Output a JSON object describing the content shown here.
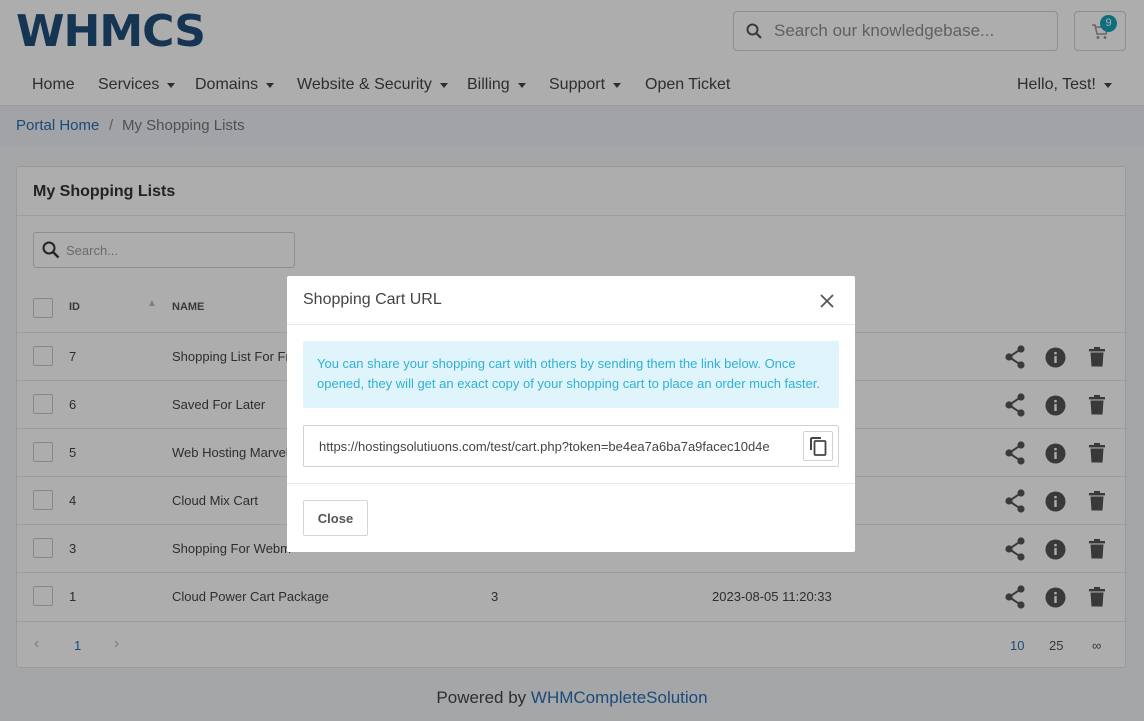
{
  "header": {
    "logo_text": "WHMCS",
    "search_placeholder": "Search our knowledgebase...",
    "cart_count": "9"
  },
  "nav": {
    "home": "Home",
    "services": "Services",
    "domains": "Domains",
    "website_security": "Website & Security",
    "billing": "Billing",
    "support": "Support",
    "open_ticket": "Open Ticket",
    "user": "Hello, Test!"
  },
  "breadcrumb": {
    "home": "Portal Home",
    "separator": "/",
    "current": "My Shopping Lists"
  },
  "panel": {
    "title": "My Shopping Lists",
    "search_placeholder": "Search...",
    "columns": {
      "id": "ID",
      "name": "NAME"
    },
    "rows": [
      {
        "id": "7",
        "name": "Shopping List For Fr",
        "items": "",
        "date": ""
      },
      {
        "id": "6",
        "name": "Saved For Later",
        "items": "",
        "date": ""
      },
      {
        "id": "5",
        "name": "Web Hosting Marvel",
        "items": "",
        "date": ""
      },
      {
        "id": "4",
        "name": "Cloud Mix Cart",
        "items": "",
        "date": ""
      },
      {
        "id": "3",
        "name": "Shopping For Webm",
        "items": "",
        "date": ""
      },
      {
        "id": "1",
        "name": "Cloud Power Cart Package",
        "items": "3",
        "date": "2023-08-05 11:20:33"
      }
    ]
  },
  "pager": {
    "current_page": "1",
    "sizes": [
      "10",
      "25",
      "∞"
    ]
  },
  "footer": {
    "prefix": "Powered by ",
    "link": "WHMCompleteSolution"
  },
  "modal": {
    "title": "Shopping Cart URL",
    "alert": "You can share your shopping cart with others by sending them the link below. Once opened, they will get an exact copy of your shopping cart to place an order much faster.",
    "url": "https://hostingsolutiuons.com/test/cart.php?token=be4ea7a6ba7a9facec10d4e",
    "close_label": "Close"
  },
  "colors": {
    "link": "#2a6db5",
    "alert_bg": "#dff4fb",
    "alert_text": "#31b0d5",
    "badge": "#17a2b8"
  }
}
